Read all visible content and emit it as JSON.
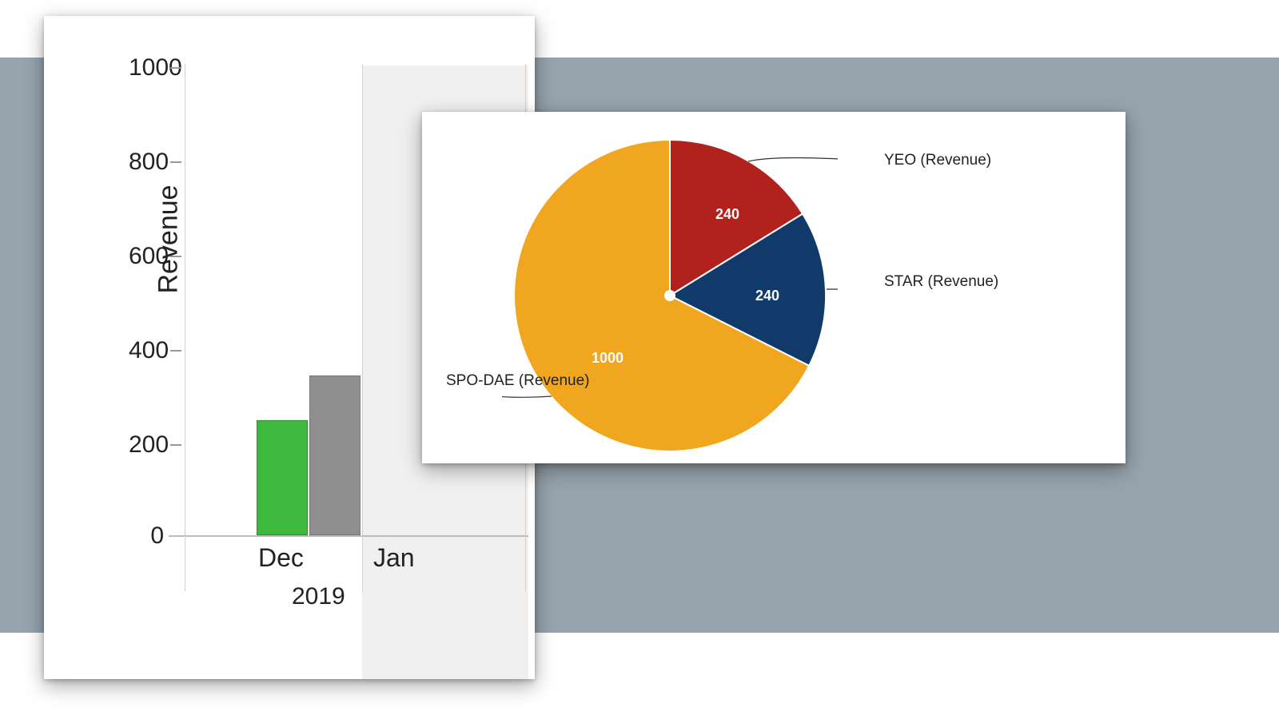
{
  "bar": {
    "ylabel": "Revenue",
    "ticks": {
      "t0": "0",
      "t200": "200",
      "t400": "400",
      "t600": "600",
      "t800": "800",
      "t1000": "1000"
    },
    "x": {
      "dec": "Dec",
      "jan": "Jan",
      "year": "2019"
    }
  },
  "pie": {
    "labels": {
      "yeo": "YEO (Revenue)",
      "star": "STAR (Revenue)",
      "spo": "SPO-DAE (Revenue)"
    },
    "values": {
      "yeo": "240",
      "star": "240",
      "spo": "1000"
    }
  },
  "chart_data": [
    {
      "type": "bar",
      "ylabel": "Revenue",
      "ylim": [
        0,
        1000
      ],
      "categories": [
        "Dec"
      ],
      "series": [
        {
          "name": "green",
          "values": [
            240
          ]
        },
        {
          "name": "grey",
          "values": [
            335
          ]
        }
      ],
      "x_group": "2019",
      "x_ticks_visible": [
        "Dec",
        "Jan"
      ]
    },
    {
      "type": "pie",
      "series": [
        {
          "name": "YEO (Revenue)",
          "value": 240,
          "color": "#b1221d"
        },
        {
          "name": "STAR (Revenue)",
          "value": 240,
          "color": "#103a6a"
        },
        {
          "name": "SPO-DAE (Revenue)",
          "value": 1000,
          "color": "#f0a61f"
        }
      ]
    }
  ]
}
